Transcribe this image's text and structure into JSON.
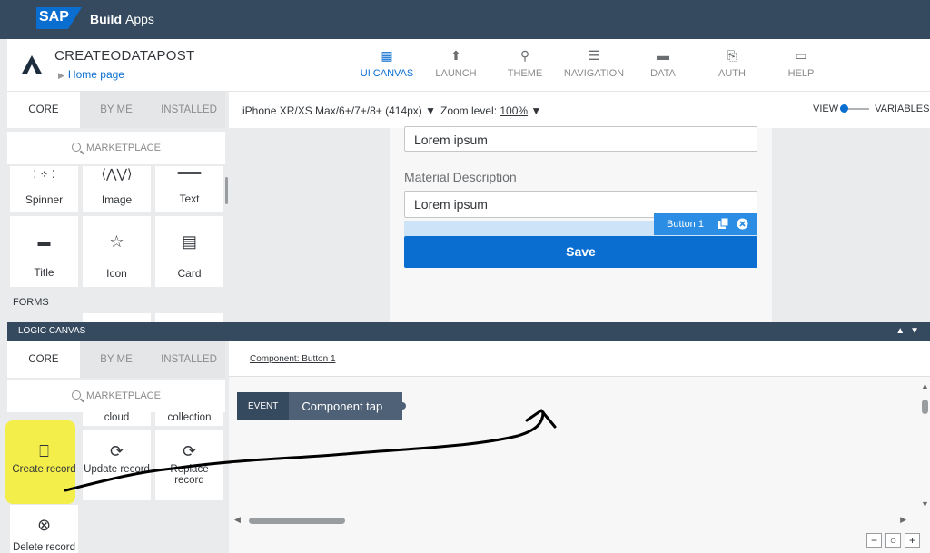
{
  "topbar": {
    "logo": "SAP",
    "product_bold": "Build",
    "product": "Apps"
  },
  "header": {
    "app_title": "CREATEODATAPOST",
    "breadcrumb": "Home page",
    "tabs": [
      {
        "label": "UI CANVAS",
        "icon": "grid-icon",
        "active": true
      },
      {
        "label": "LAUNCH",
        "icon": "upload-icon"
      },
      {
        "label": "THEME",
        "icon": "brush-icon"
      },
      {
        "label": "NAVIGATION",
        "icon": "list-icon"
      },
      {
        "label": "DATA",
        "icon": "folder-icon"
      },
      {
        "label": "AUTH",
        "icon": "code-file-icon"
      },
      {
        "label": "HELP",
        "icon": "chat-icon"
      }
    ]
  },
  "ui_panel": {
    "tabs": [
      "CORE",
      "BY ME",
      "INSTALLED"
    ],
    "active_tab": "CORE",
    "marketplace": "MARKETPLACE",
    "components": [
      {
        "label": "Spinner",
        "icon": "spinner-icon"
      },
      {
        "label": "Image",
        "icon": "image-icon"
      },
      {
        "label": "Text",
        "icon": "text-icon"
      },
      {
        "label": "Title",
        "icon": "title-icon"
      },
      {
        "label": "Icon",
        "icon": "star-icon"
      },
      {
        "label": "Card",
        "icon": "card-icon"
      }
    ],
    "section": "FORMS"
  },
  "toolbar": {
    "device": "iPhone XR/XS Max/6+/7+/8+ (414px)",
    "zoom_label": "Zoom level:",
    "zoom_value": "100%",
    "view_label": "VIEW",
    "variables_label": "VARIABLES"
  },
  "phone": {
    "field1_value": "Lorem ipsum",
    "field2_label": "Material Description",
    "field2_value": "Lorem ipsum",
    "save_label": "Save",
    "selection_tag": "Button 1"
  },
  "logic_bar": {
    "title": "LOGIC CANVAS"
  },
  "logic_panel": {
    "tabs": [
      "CORE",
      "BY ME",
      "INSTALLED"
    ],
    "active_tab": "CORE",
    "marketplace": "MARKETPLACE",
    "partial_labels": [
      "cloud",
      "collection"
    ],
    "components": [
      {
        "label": "Create record",
        "icon": "create-record-icon",
        "highlighted": true
      },
      {
        "label": "Update record",
        "icon": "update-record-icon"
      },
      {
        "label": "Replace record",
        "icon": "replace-record-icon"
      },
      {
        "label": "Delete record",
        "icon": "delete-record-icon"
      }
    ]
  },
  "logic_canvas": {
    "component_link": "Component: Button 1",
    "event_type": "EVENT",
    "event_name": "Component tap"
  },
  "colors": {
    "topbar": "#354a5f",
    "accent": "#0a6ed1",
    "highlight": "#f4ee4a",
    "arrow": "#000000"
  }
}
